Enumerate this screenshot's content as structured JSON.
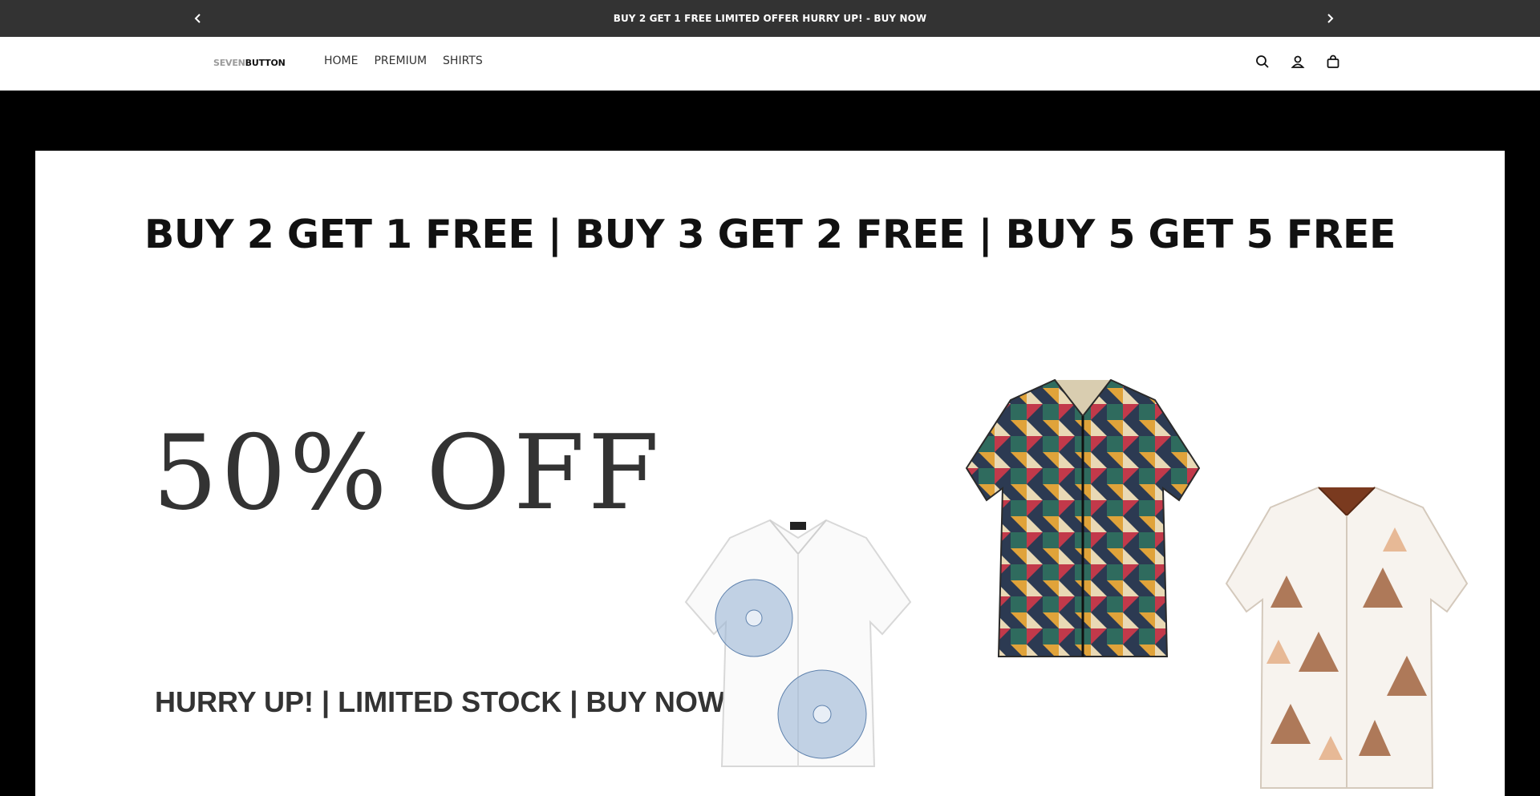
{
  "announcement": {
    "text": "BUY 2 GET 1 FREE LIMITED OFFER HURRY UP! - BUY NOW",
    "prev_icon": "chevron-left-icon",
    "next_icon": "chevron-right-icon"
  },
  "header": {
    "logo_part1": "SEVEN",
    "logo_part2": "BUTTON",
    "nav": [
      "HOME",
      "PREMIUM",
      "SHIRTS"
    ],
    "icons": [
      "search-icon",
      "account-icon",
      "cart-icon"
    ]
  },
  "hero": {
    "promo_headline": "BUY 2 GET 1 FREE | BUY 3 GET 2 FREE | BUY 5 GET 5 FREE",
    "discount": "50% OFF",
    "urgency": "HURRY UP! | LIMITED STOCK | BUY NOW",
    "products": [
      "white shirt with blue flower print",
      "multicolor geometric patterned shirt",
      "white shirt with brown triangle print"
    ]
  },
  "colors": {
    "announcement_bg": "#333333",
    "hero_bg": "#000000",
    "panel_bg": "#ffffff",
    "text_dark": "#111111"
  }
}
